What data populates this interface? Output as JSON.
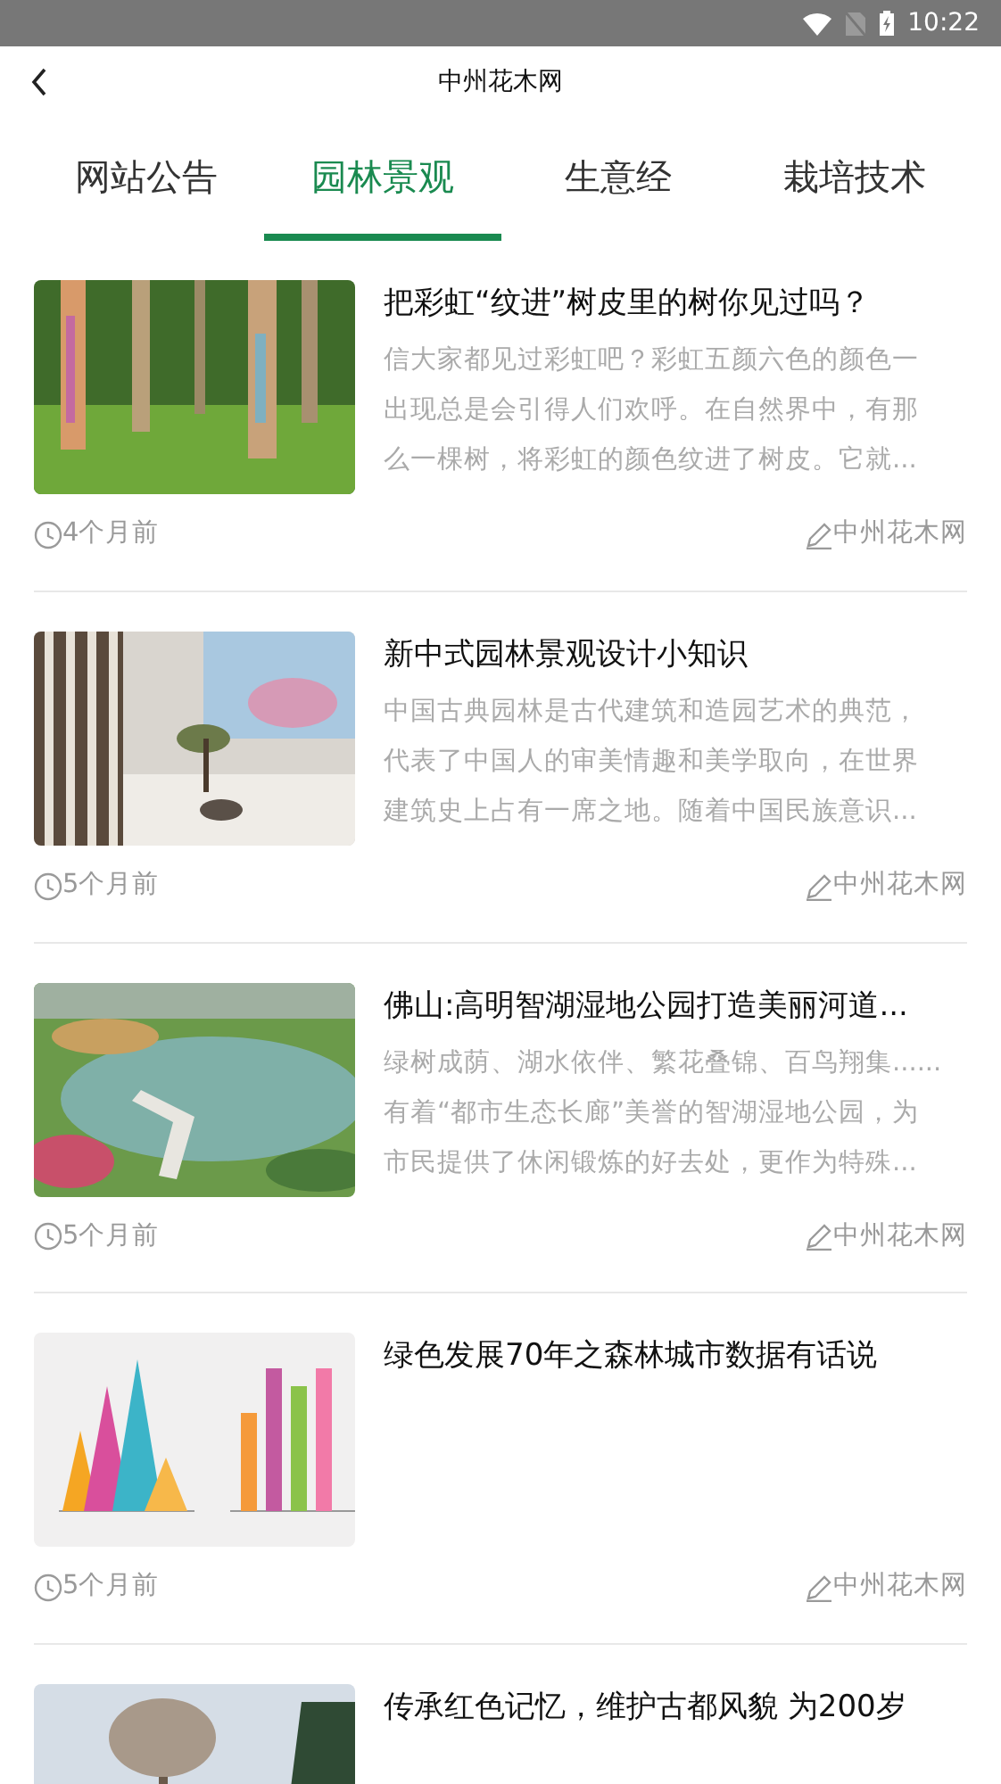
{
  "status_bar": {
    "time": "10:22"
  },
  "header": {
    "title": "中州花木网"
  },
  "tabs": [
    {
      "label": "网站公告",
      "selected": false
    },
    {
      "label": "园林景观",
      "selected": true
    },
    {
      "label": "生意经",
      "selected": false
    },
    {
      "label": "栽培技术",
      "selected": false
    }
  ],
  "articles": [
    {
      "title": "把彩虹“纹进”树皮里的树你见过吗？",
      "summary": "信大家都见过彩虹吧？彩虹五颜六色的颜色一出现总是会引得人们欢呼。在自然界中，有那么一棵树，将彩虹的颜色纹进了树皮。它就...",
      "time": "4个月前",
      "author": "中州花木网"
    },
    {
      "title": "新中式园林景观设计小知识",
      "summary": "中国古典园林是古代建筑和造园艺术的典范，代表了中国人的审美情趣和美学取向，在世界建筑史上占有一席之地。随着中国民族意识...",
      "time": "5个月前",
      "author": "中州花木网"
    },
    {
      "title": "佛山:高明智湖湿地公园打造美丽河道...",
      "summary": "绿树成荫、湖水依伴、繁花叠锦、百鸟翔集......有着“都市生态长廊”美誉的智湖湿地公园，为市民提供了休闲锻炼的好去处，更作为特殊...",
      "time": "5个月前",
      "author": "中州花木网"
    },
    {
      "title": "绿色发展70年之森林城市数据有话说",
      "time": "5个月前",
      "author": "中州花木网"
    },
    {
      "title": "传承红色记忆，维护古都风貌 为200岁"
    }
  ]
}
